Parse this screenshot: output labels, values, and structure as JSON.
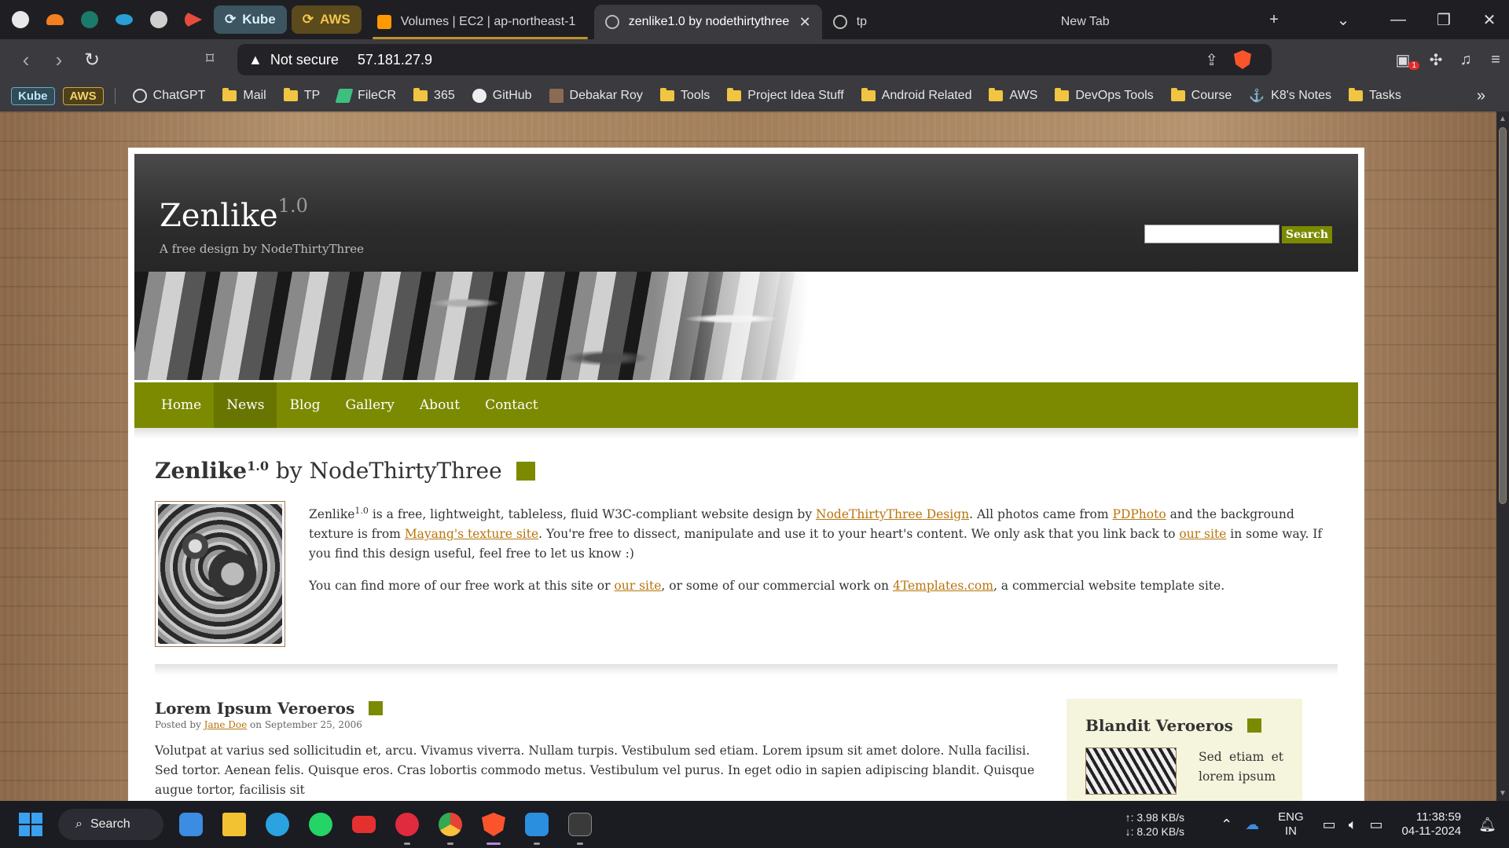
{
  "browser": {
    "group_kube": "Kube",
    "group_aws": "AWS",
    "tabs": [
      {
        "title": "Volumes | EC2 | ap-northeast-1",
        "favicon_color": "#ff9900"
      },
      {
        "title": "zenlike1.0 by nodethirtythree",
        "favicon_color": "#888888"
      },
      {
        "title": "tp",
        "favicon_color": "#888888"
      },
      {
        "title": "New Tab",
        "favicon_color": ""
      }
    ],
    "security_label": "Not secure",
    "url": "57.181.27.9",
    "ext_badge": "1"
  },
  "bookmarks": {
    "chip_kube": "Kube",
    "chip_aws": "AWS",
    "items": [
      {
        "label": "ChatGPT",
        "icon": "chatgpt-icon"
      },
      {
        "label": "Mail",
        "icon": "folder-icon"
      },
      {
        "label": "TP",
        "icon": "folder-icon"
      },
      {
        "label": "FileCR",
        "icon": "filecr-icon"
      },
      {
        "label": "365",
        "icon": "folder-icon"
      },
      {
        "label": "GitHub",
        "icon": "github-icon"
      },
      {
        "label": "Debakar Roy",
        "icon": "avatar-icon"
      },
      {
        "label": "Tools",
        "icon": "folder-icon"
      },
      {
        "label": "Project Idea Stuff",
        "icon": "folder-icon"
      },
      {
        "label": "Android Related",
        "icon": "folder-icon"
      },
      {
        "label": "AWS",
        "icon": "folder-icon"
      },
      {
        "label": "DevOps Tools",
        "icon": "folder-icon"
      },
      {
        "label": "Course",
        "icon": "folder-icon"
      },
      {
        "label": "K8's Notes",
        "icon": "anchor-icon"
      },
      {
        "label": "Tasks",
        "icon": "folder-icon"
      }
    ],
    "more": "»"
  },
  "site": {
    "logo": "Zenlike",
    "logo_version": "1.0",
    "tagline": "A free design by NodeThirtyThree",
    "search_button": "Search",
    "menu": [
      "Home",
      "News",
      "Blog",
      "Gallery",
      "About",
      "Contact"
    ],
    "page_title_bold": "Zenlike",
    "page_title_sup": "1.0",
    "page_title_rest": " by NodeThirtyThree",
    "intro": {
      "p1_a": "Zenlike",
      "p1_sup": "1.0",
      "p1_b": " is a free, lightweight, tableless, fluid W3C-compliant website design by ",
      "link1": "NodeThirtyThree Design",
      "p1_c": ". All photos came from ",
      "link2": "PDPhoto",
      "p1_d": " and the background texture is from ",
      "link3": "Mayang's texture site",
      "p1_e": ". You're free to dissect, manipulate and use it to your heart's content. We only ask that you link back to ",
      "link4": "our site",
      "p1_f": " in some way. If you find this design useful, feel free to let us know :)",
      "p2_a": "You can find more of our free work at this site or ",
      "link5": "our site",
      "p2_b": ", or some of our commercial work on ",
      "link6": "4Templates.com",
      "p2_c": ", a commercial website template site."
    },
    "post": {
      "title": "Lorem Ipsum Veroeros",
      "posted_by": "Posted by ",
      "author": "Jane Doe",
      "date": " on September 25, 2006",
      "body": "Volutpat at varius sed sollicitudin et, arcu. Vivamus viverra. Nullam turpis. Vestibulum sed etiam. Lorem ipsum sit amet dolore. Nulla facilisi. Sed tortor. Aenean felis. Quisque eros. Cras lobortis commodo metus. Vestibulum vel purus. In eget odio in sapien adipiscing blandit. Quisque augue tortor, facilisis sit"
    },
    "sidebar": {
      "title": "Blandit Veroeros",
      "text": "Sed etiam et lorem ipsum"
    }
  },
  "taskbar": {
    "search_label": "Search",
    "upload": "↑: 3.98 KB/s",
    "download": "↓: 8.20 KB/s",
    "lang1": "ENG",
    "lang2": "IN",
    "time": "11:38:59",
    "date": "04-11-2024"
  },
  "colors": {
    "accent_olive": "#7b8a00",
    "link_orange": "#b8760d"
  }
}
